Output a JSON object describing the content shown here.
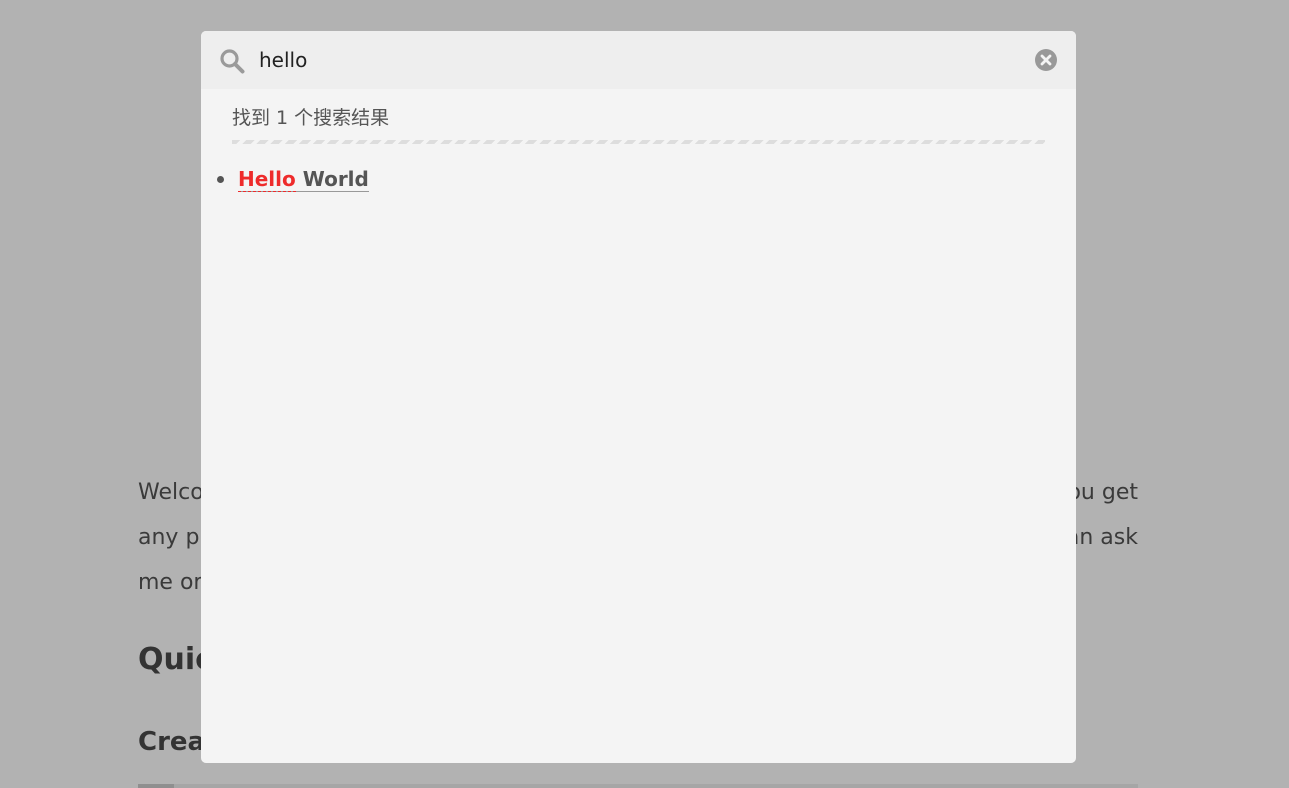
{
  "article": {
    "line1_left": "Welco",
    "line1_right": "ou get",
    "line2_left": "any p",
    "line2_right": "an ask",
    "line3_left": "me or",
    "heading2": "Quic",
    "heading3": "Crea"
  },
  "search": {
    "query": "hello",
    "stats": "找到 1 个搜索结果",
    "results": [
      {
        "keyword": "Hello",
        "rest": " World"
      }
    ]
  },
  "colors": {
    "overlay": "#b2b2b2",
    "popup": "#f4f4f4",
    "highlight": "#ee2b2b"
  },
  "icons": {
    "search": "search-icon",
    "clear": "close-circle-icon"
  }
}
